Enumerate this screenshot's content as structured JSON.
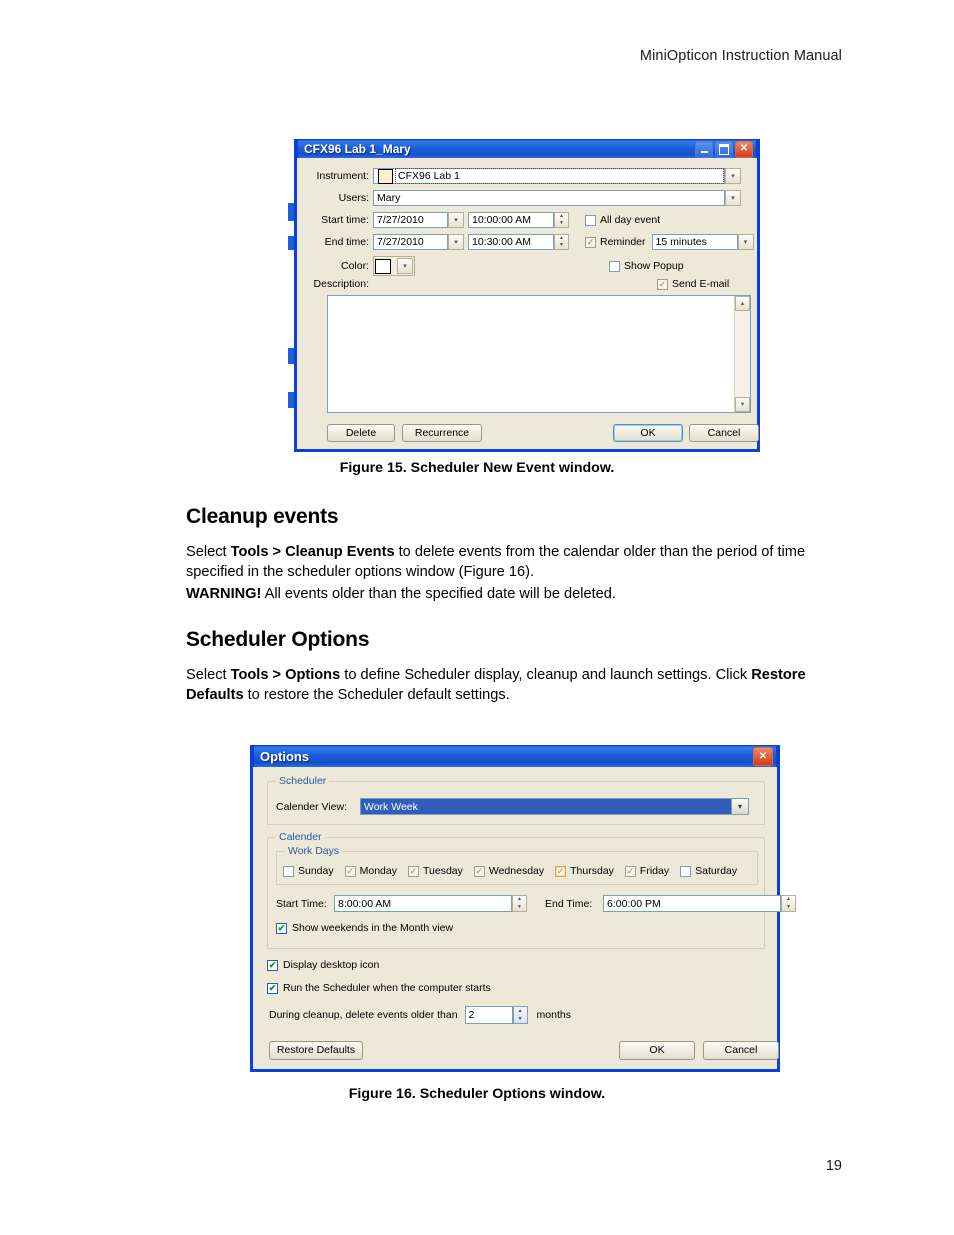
{
  "page": {
    "header": "MiniOpticon Instruction Manual",
    "number": "19"
  },
  "figures": {
    "fig15_caption": "Figure 15. Scheduler New Event window.",
    "fig16_caption": "Figure 16. Scheduler Options window."
  },
  "sections": [
    {
      "heading": "Cleanup events",
      "paragraph_1_a": "Select ",
      "paragraph_1_b": "Tools > Cleanup Events",
      "paragraph_1_c": " to delete events from the calendar older than the period of time specified in the scheduler options window (Figure 16).",
      "warning_label": "WARNING!",
      "warning_text": " All events older than the specified date will be deleted."
    },
    {
      "heading": "Scheduler Options",
      "paragraph_1_a": "Select ",
      "paragraph_1_b": "Tools > Options",
      "paragraph_1_c": " to define Scheduler display, cleanup and launch settings. Click ",
      "paragraph_1_d": "Restore Defaults",
      "paragraph_1_e": " to restore the Scheduler default settings."
    }
  ],
  "new_event_dialog": {
    "title": "CFX96 Lab 1_Mary",
    "titlebar_buttons": {
      "minimize": "minimize-icon",
      "maximize": "maximize-icon",
      "close": "close-icon"
    },
    "labels": {
      "instrument": "Instrument:",
      "users": "Users:",
      "start_time": "Start time:",
      "end_time": "End time:",
      "color": "Color:",
      "description": "Description:"
    },
    "values": {
      "instrument": "CFX96 Lab 1",
      "instrument_swatch": "#f7f2cf",
      "users": "Mary",
      "start_date": "7/27/2010",
      "start_clock": "10:00:00 AM",
      "end_date": "7/27/2010",
      "end_clock": "10:30:00 AM",
      "color_swatch": "#ffffff",
      "description": ""
    },
    "checkboxes": {
      "all_day_event": {
        "label": "All day event",
        "checked": false
      },
      "reminder": {
        "label": "Reminder",
        "checked": true
      },
      "show_popup": {
        "label": "Show Popup",
        "checked": false
      },
      "send_email": {
        "label": "Send E-mail",
        "checked": true
      }
    },
    "reminder_value": "15 minutes",
    "buttons": {
      "delete": "Delete",
      "recurrence": "Recurrence",
      "ok": "OK",
      "cancel": "Cancel"
    }
  },
  "options_dialog": {
    "title": "Options",
    "close_button": "close-icon",
    "groups": {
      "scheduler": "Scheduler",
      "calender": "Calender",
      "work_days": "Work Days"
    },
    "calender_view_label": "Calender View:",
    "calender_view_value": "Work Week",
    "work_days": [
      {
        "label": "Sunday",
        "checked": false,
        "focused": false
      },
      {
        "label": "Monday",
        "checked": true,
        "focused": false
      },
      {
        "label": "Tuesday",
        "checked": true,
        "focused": false
      },
      {
        "label": "Wednesday",
        "checked": true,
        "focused": false
      },
      {
        "label": "Thursday",
        "checked": true,
        "focused": true
      },
      {
        "label": "Friday",
        "checked": true,
        "focused": false
      },
      {
        "label": "Saturday",
        "checked": false,
        "focused": false
      }
    ],
    "start_time_label": "Start Time:",
    "start_time_value": "8:00:00 AM",
    "end_time_label": "End Time:",
    "end_time_value": "6:00:00 PM",
    "show_weekends": {
      "label": "Show weekends in the Month view",
      "checked": true
    },
    "display_desktop_icon": {
      "label": "Display desktop icon",
      "checked": true
    },
    "run_on_start": {
      "label": "Run the Scheduler when the computer starts",
      "checked": true
    },
    "cleanup_prefix": "During cleanup, delete events older than",
    "cleanup_value": "2",
    "cleanup_suffix": "months",
    "buttons": {
      "restore_defaults": "Restore Defaults",
      "ok": "OK",
      "cancel": "Cancel"
    }
  }
}
